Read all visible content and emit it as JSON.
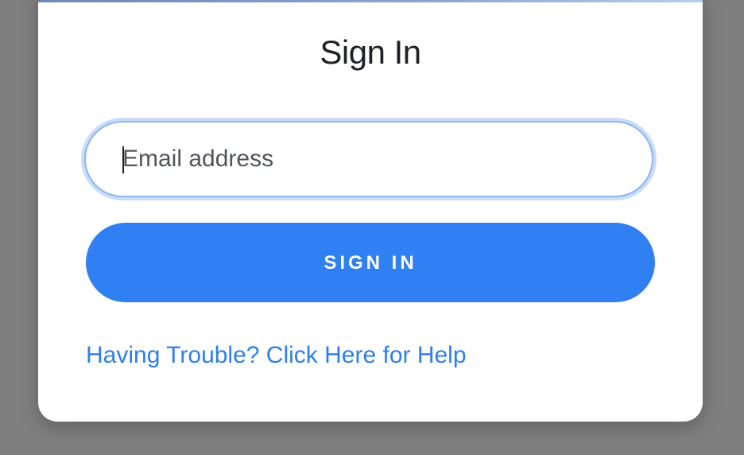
{
  "dialog": {
    "title": "Sign In",
    "email_field": {
      "placeholder": "Email address",
      "value": ""
    },
    "submit_label": "SIGN IN",
    "help_link": "Having Trouble? Click Here for Help"
  },
  "colors": {
    "backdrop": "#7f7f7f",
    "primary": "#3180f3",
    "link": "#2f7fe8",
    "focus_ring": "#c9ddf8"
  }
}
